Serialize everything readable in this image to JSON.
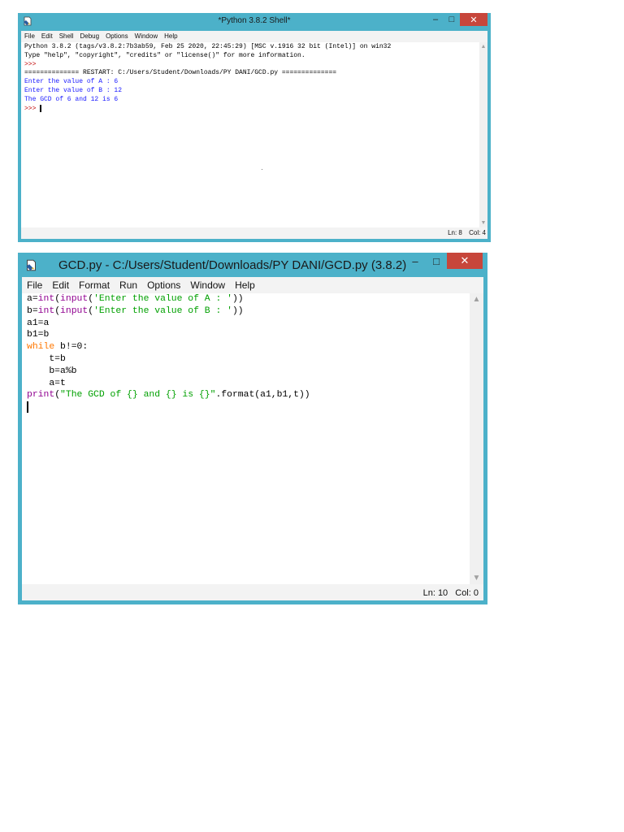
{
  "shell_window": {
    "title": "*Python 3.8.2 Shell*",
    "controls": {
      "minimize": "–",
      "maximize": "□",
      "close": "✕"
    },
    "menu": [
      "File",
      "Edit",
      "Shell",
      "Debug",
      "Options",
      "Window",
      "Help"
    ],
    "lines": [
      {
        "text": "Python 3.8.2 (tags/v3.8.2:7b3ab59, Feb 25 2020, 22:45:29) [MSC v.1916 32 bit (Intel)] on win32",
        "color": "black"
      },
      {
        "text": "Type \"help\", \"copyright\", \"credits\" or \"license()\" for more information.",
        "color": "black"
      },
      {
        "text": ">>> ",
        "color": "red"
      },
      {
        "text": "============== RESTART: C:/Users/Student/Downloads/PY DANI/GCD.py ==============",
        "color": "black"
      },
      {
        "text": "Enter the value of A : 6",
        "color": "blue"
      },
      {
        "text": "Enter the value of B : 12",
        "color": "blue"
      },
      {
        "text": "The GCD of 6 and 12 is 6",
        "color": "blue"
      }
    ],
    "prompt": ">>> ",
    "status": {
      "line": "Ln: 8",
      "col": "Col: 4"
    }
  },
  "editor_window": {
    "title": "GCD.py - C:/Users/Student/Downloads/PY DANI/GCD.py (3.8.2)",
    "controls": {
      "minimize": "–",
      "maximize": "□",
      "close": "✕"
    },
    "menu": [
      "File",
      "Edit",
      "Format",
      "Run",
      "Options",
      "Window",
      "Help"
    ],
    "code": [
      [
        {
          "text": "a=",
          "color": "black"
        },
        {
          "text": "int",
          "color": "purple"
        },
        {
          "text": "(",
          "color": "black"
        },
        {
          "text": "input",
          "color": "purple"
        },
        {
          "text": "(",
          "color": "black"
        },
        {
          "text": "'Enter the value of A : '",
          "color": "green"
        },
        {
          "text": "))",
          "color": "black"
        }
      ],
      [
        {
          "text": "b=",
          "color": "black"
        },
        {
          "text": "int",
          "color": "purple"
        },
        {
          "text": "(",
          "color": "black"
        },
        {
          "text": "input",
          "color": "purple"
        },
        {
          "text": "(",
          "color": "black"
        },
        {
          "text": "'Enter the value of B : '",
          "color": "green"
        },
        {
          "text": "))",
          "color": "black"
        }
      ],
      [
        {
          "text": "a1=a",
          "color": "black"
        }
      ],
      [
        {
          "text": "b1=b",
          "color": "black"
        }
      ],
      [
        {
          "text": "while",
          "color": "orange"
        },
        {
          "text": " b!=0:",
          "color": "black"
        }
      ],
      [
        {
          "text": "    t=b",
          "color": "black"
        }
      ],
      [
        {
          "text": "    b=a%b",
          "color": "black"
        }
      ],
      [
        {
          "text": "    a=t",
          "color": "black"
        }
      ],
      [
        {
          "text": "print",
          "color": "purple"
        },
        {
          "text": "(",
          "color": "black"
        },
        {
          "text": "\"The GCD of {} and {} is {}\"",
          "color": "green"
        },
        {
          "text": ".format(a1,b1,t))",
          "color": "black"
        }
      ]
    ],
    "status": {
      "line": "Ln: 10",
      "col": "Col: 0"
    }
  }
}
